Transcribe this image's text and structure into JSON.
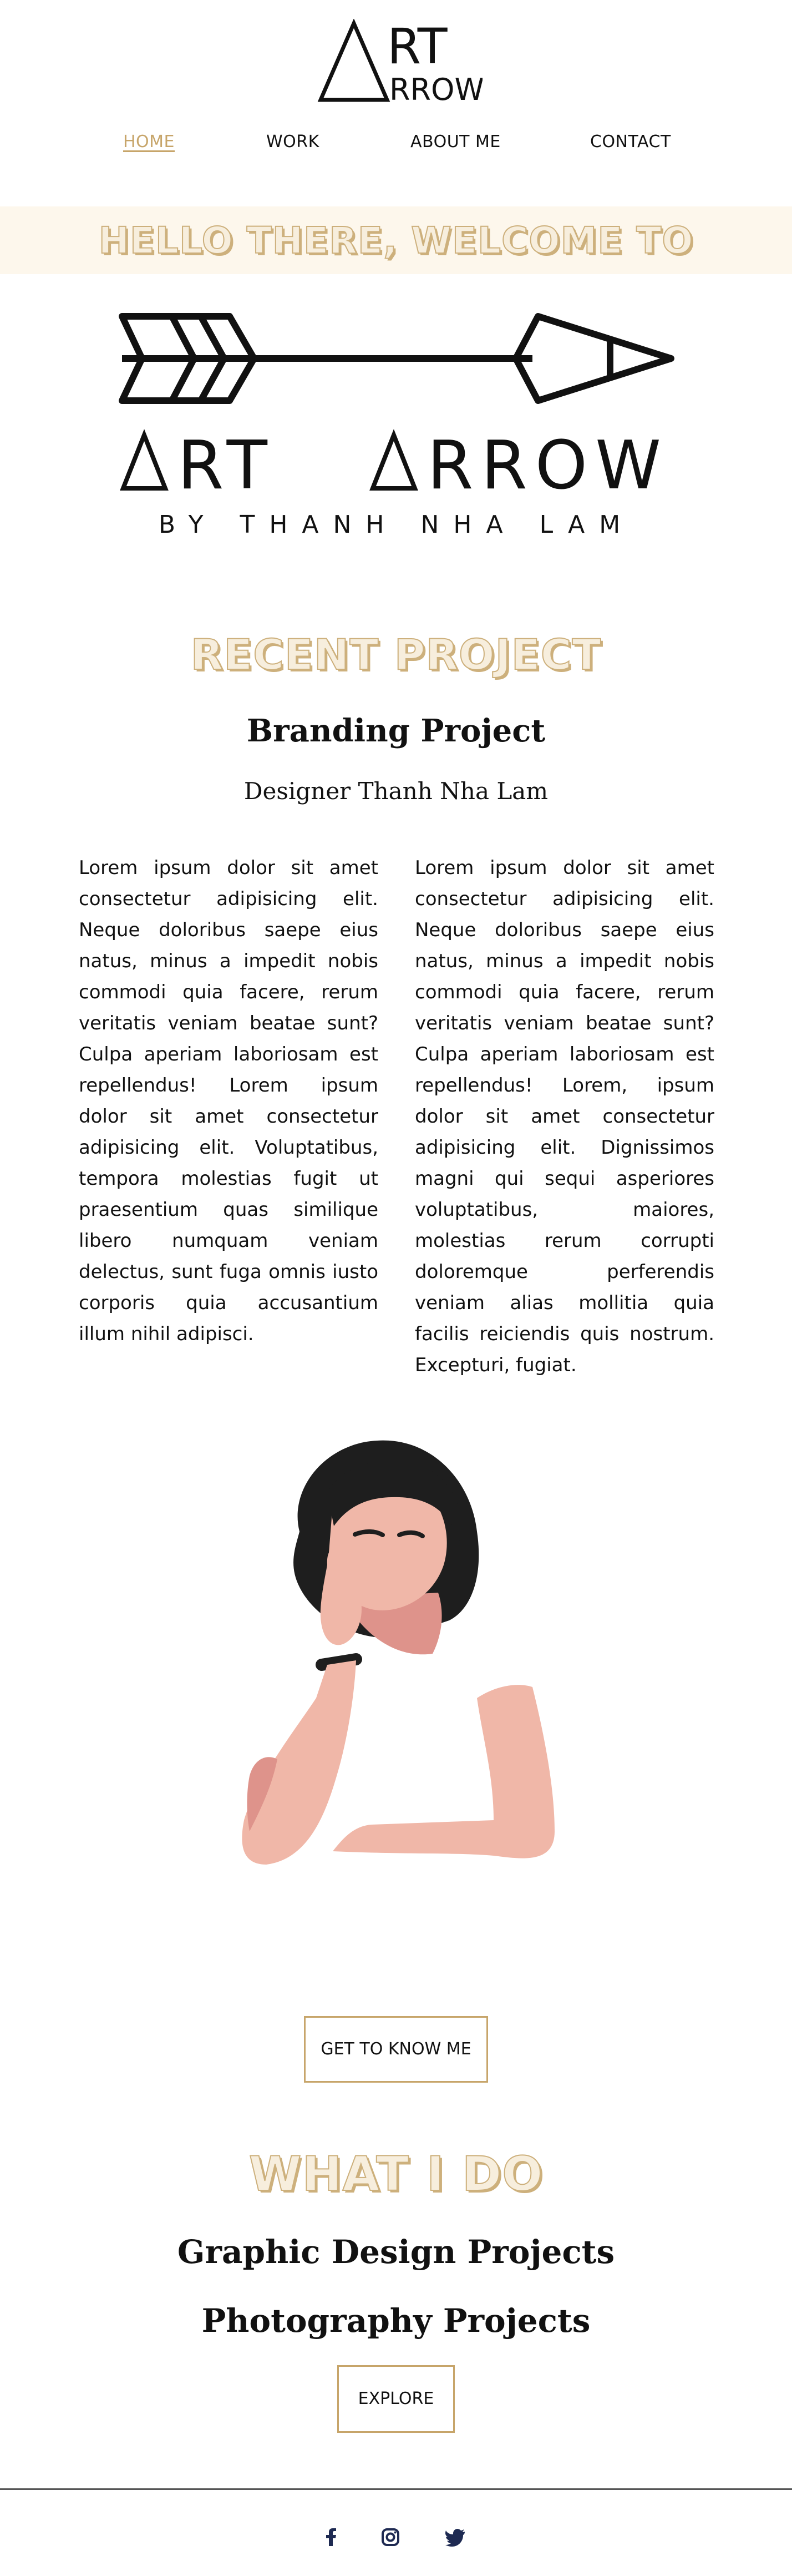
{
  "header": {
    "logo_text_top": "RT",
    "logo_text_bottom": "RROW"
  },
  "nav": {
    "items": [
      "HOME",
      "WORK",
      "ABOUT ME",
      "CONTACT"
    ],
    "active": "HOME"
  },
  "banner": {
    "text": "HELLO THERE, WELCOME TO"
  },
  "brand": {
    "name": "ART ARROW",
    "byline": "BY THANH NHA LAM"
  },
  "recent": {
    "heading": "RECENT PROJECT",
    "title": "Branding Project",
    "subtitle": "Designer Thanh Nha Lam",
    "col_left": "Lorem ipsum dolor sit amet consectetur adipisicing elit. Neque doloribus saepe eius natus, minus a impedit nobis commodi quia facere, rerum veritatis veniam beatae sunt? Culpa aperiam laboriosam est repellendus! Lorem ipsum dolor sit amet consectetur adipisicing elit. Voluptatibus, tempora molestias fugit ut praesentium quas similique libero numquam veniam delectus, sunt fuga omnis iusto corporis quia accusantium illum nihil adipisci.",
    "col_right": "Lorem ipsum dolor sit amet consectetur adipisicing elit. Neque doloribus saepe eius natus, minus a impedit nobis commodi quia facere, rerum veritatis veniam beatae sunt? Culpa aperiam laboriosam est repellendus! Lorem, ipsum dolor sit amet consectetur adipisicing elit. Dignissimos magni qui sequi asperiores voluptatibus, maiores, molestias rerum corrupti doloremque perferendis veniam alias mollitia quia facilis reiciendis quis nostrum. Excepturi, fugiat."
  },
  "cta": {
    "know_label": "GET TO KNOW ME"
  },
  "whatido": {
    "heading": "WHAT I DO",
    "services": [
      "Graphic Design Projects",
      "Photography Projects"
    ],
    "explore_label": "EXPLORE"
  },
  "footer": {
    "icons": [
      "facebook-icon",
      "instagram-icon",
      "twitter-icon"
    ]
  },
  "colors": {
    "accent": "#c7a56a",
    "banner_bg": "#fdf7ec",
    "skin": "#f0b7a8",
    "skin_shadow": "#de938b",
    "hair": "#1e1e1e",
    "footer_icon": "#1e2a52"
  }
}
